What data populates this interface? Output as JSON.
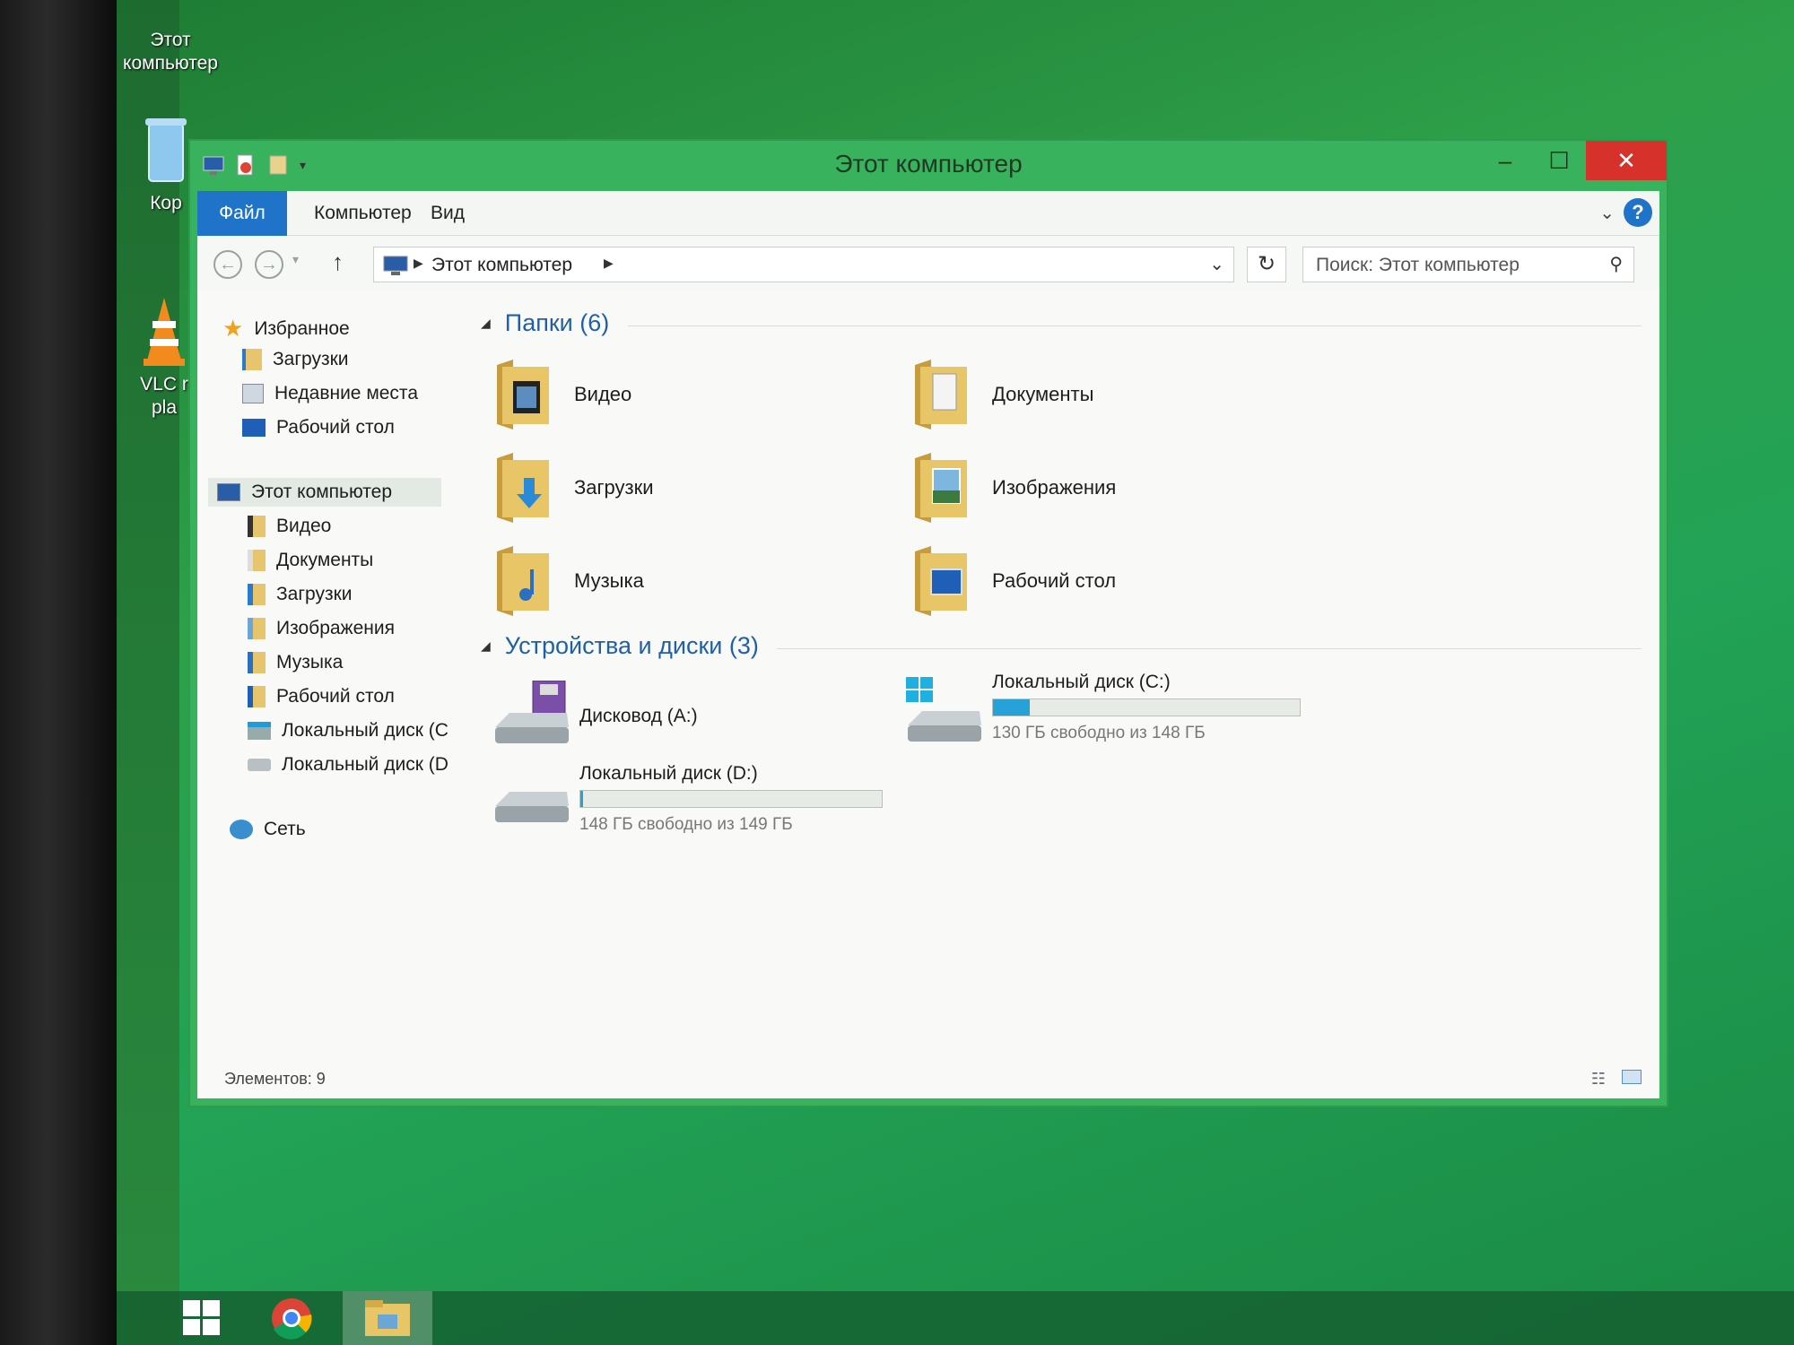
{
  "desktop": {
    "icons": [
      {
        "label": "Этот\nкомпьютер"
      },
      {
        "label": "Кор"
      },
      {
        "label": "VLC r\npla"
      }
    ]
  },
  "window": {
    "title": "Этот компьютер",
    "buttons": {
      "minimize": "–",
      "maximize": "☐",
      "close": "✕"
    }
  },
  "ribbon": {
    "tabs": [
      "Файл",
      "Компьютер",
      "Вид"
    ],
    "help": "?"
  },
  "address": {
    "crumb": "Этот компьютер",
    "search_placeholder": "Поиск: Этот компьютер"
  },
  "nav": {
    "favorites": {
      "title": "Избранное",
      "items": [
        "Загрузки",
        "Недавние места",
        "Рабочий стол"
      ]
    },
    "this_pc": {
      "title": "Этот компьютер",
      "items": [
        "Видео",
        "Документы",
        "Загрузки",
        "Изображения",
        "Музыка",
        "Рабочий стол",
        "Локальный диск (C",
        "Локальный диск (D"
      ]
    },
    "network": "Сеть"
  },
  "folders": {
    "header": "Папки (6)",
    "items": [
      "Видео",
      "Документы",
      "Загрузки",
      "Изображения",
      "Музыка",
      "Рабочий стол"
    ]
  },
  "devices": {
    "header": "Устройства и диски (3)",
    "floppy": {
      "name": "Дисковод (A:)"
    },
    "disk_c": {
      "name": "Локальный диск (C:)",
      "free": "130 ГБ свободно из 148 ГБ",
      "used_fraction": 0.12
    },
    "disk_d": {
      "name": "Локальный диск (D:)",
      "free": "148 ГБ свободно из 149 ГБ",
      "used_fraction": 0.01
    }
  },
  "status": {
    "count": "Элементов: 9"
  },
  "colors": {
    "accent": "#1f73c9",
    "title_bar": "#38b25c",
    "close": "#d6312a",
    "header_text": "#2160a8",
    "disk_fill": "#27a2d9"
  }
}
